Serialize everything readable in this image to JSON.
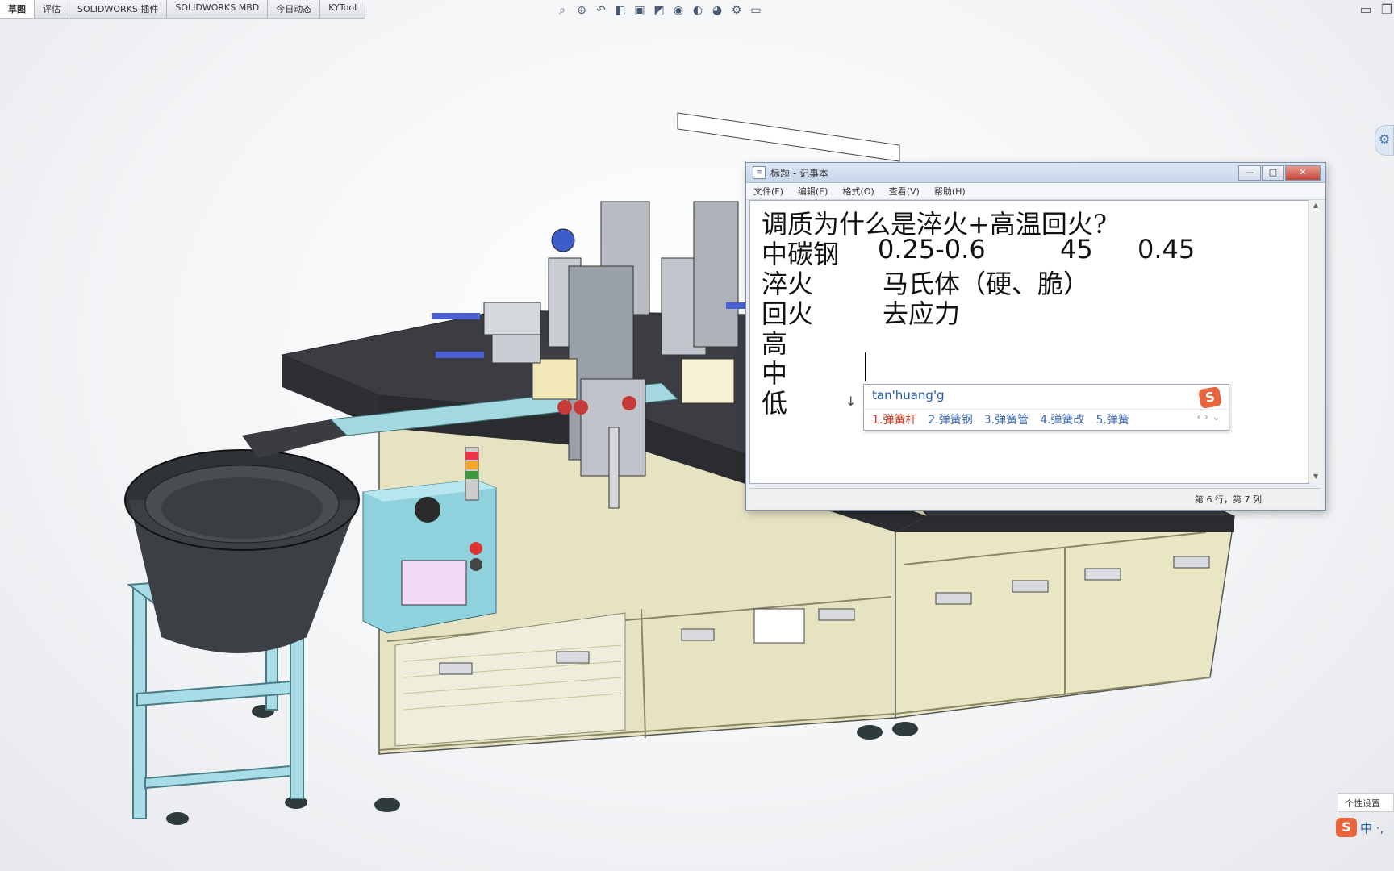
{
  "solidworks": {
    "tabs": [
      "草图",
      "评估",
      "SOLIDWORKS 插件",
      "SOLIDWORKS MBD",
      "今日动态",
      "KYTool"
    ],
    "active_tab_index": 0,
    "hud_icons": [
      "zoom-fit-icon",
      "zoom-area-icon",
      "previous-view-icon",
      "section-view-icon",
      "view-orientation-icon",
      "display-style-icon",
      "hide-show-icon",
      "edit-appearance-icon",
      "scene-icon",
      "view-settings-icon",
      "monitor-icon"
    ]
  },
  "notepad": {
    "title": "标题 - 记事本",
    "menu": [
      "文件(F)",
      "编辑(E)",
      "格式(O)",
      "查看(V)",
      "帮助(H)"
    ],
    "lines": [
      {
        "c1": "调质为什么是淬火+高温回火?",
        "c2": "",
        "c3": "",
        "c4": ""
      },
      {
        "c1": "中碳钢",
        "c2": "0.25-0.6",
        "c3": "45",
        "c4": "0.45"
      },
      {
        "c1": "淬火",
        "c2": "马氏体（硬、脆）",
        "c3": "",
        "c4": ""
      },
      {
        "c1": "回火",
        "c2": "去应力",
        "c3": "",
        "c4": ""
      },
      {
        "c1": "高",
        "c2": "",
        "c3": "",
        "c4": ""
      },
      {
        "c1": "中",
        "c2": "",
        "c3": "",
        "c4": ""
      },
      {
        "c1": "低",
        "c2": "",
        "c3": "",
        "c4": ""
      }
    ],
    "status": "第 6 行，第 7 列",
    "buttons": {
      "minimize": "—",
      "maximize": "□",
      "close": "✕"
    }
  },
  "ime": {
    "input": "tan'huang'g",
    "candidates": [
      "1.弹簧杆",
      "2.弹簧钢",
      "3.弹簧管",
      "4.弹簧改",
      "5.弹簧"
    ],
    "nav": "‹ › ⌄",
    "logo": "S"
  },
  "tray": {
    "tooltip": "个性设置",
    "ime_logo": "S",
    "ime_text": "中 ·,"
  },
  "colors": {
    "frame_yellow": "#e9e6c4",
    "tabletop": "#3b3d42",
    "bowl": "#3c3f44",
    "stand_cyan": "#a8dce6",
    "control_box": "#8fd2de",
    "notepad_border": "#7d8fa8"
  }
}
